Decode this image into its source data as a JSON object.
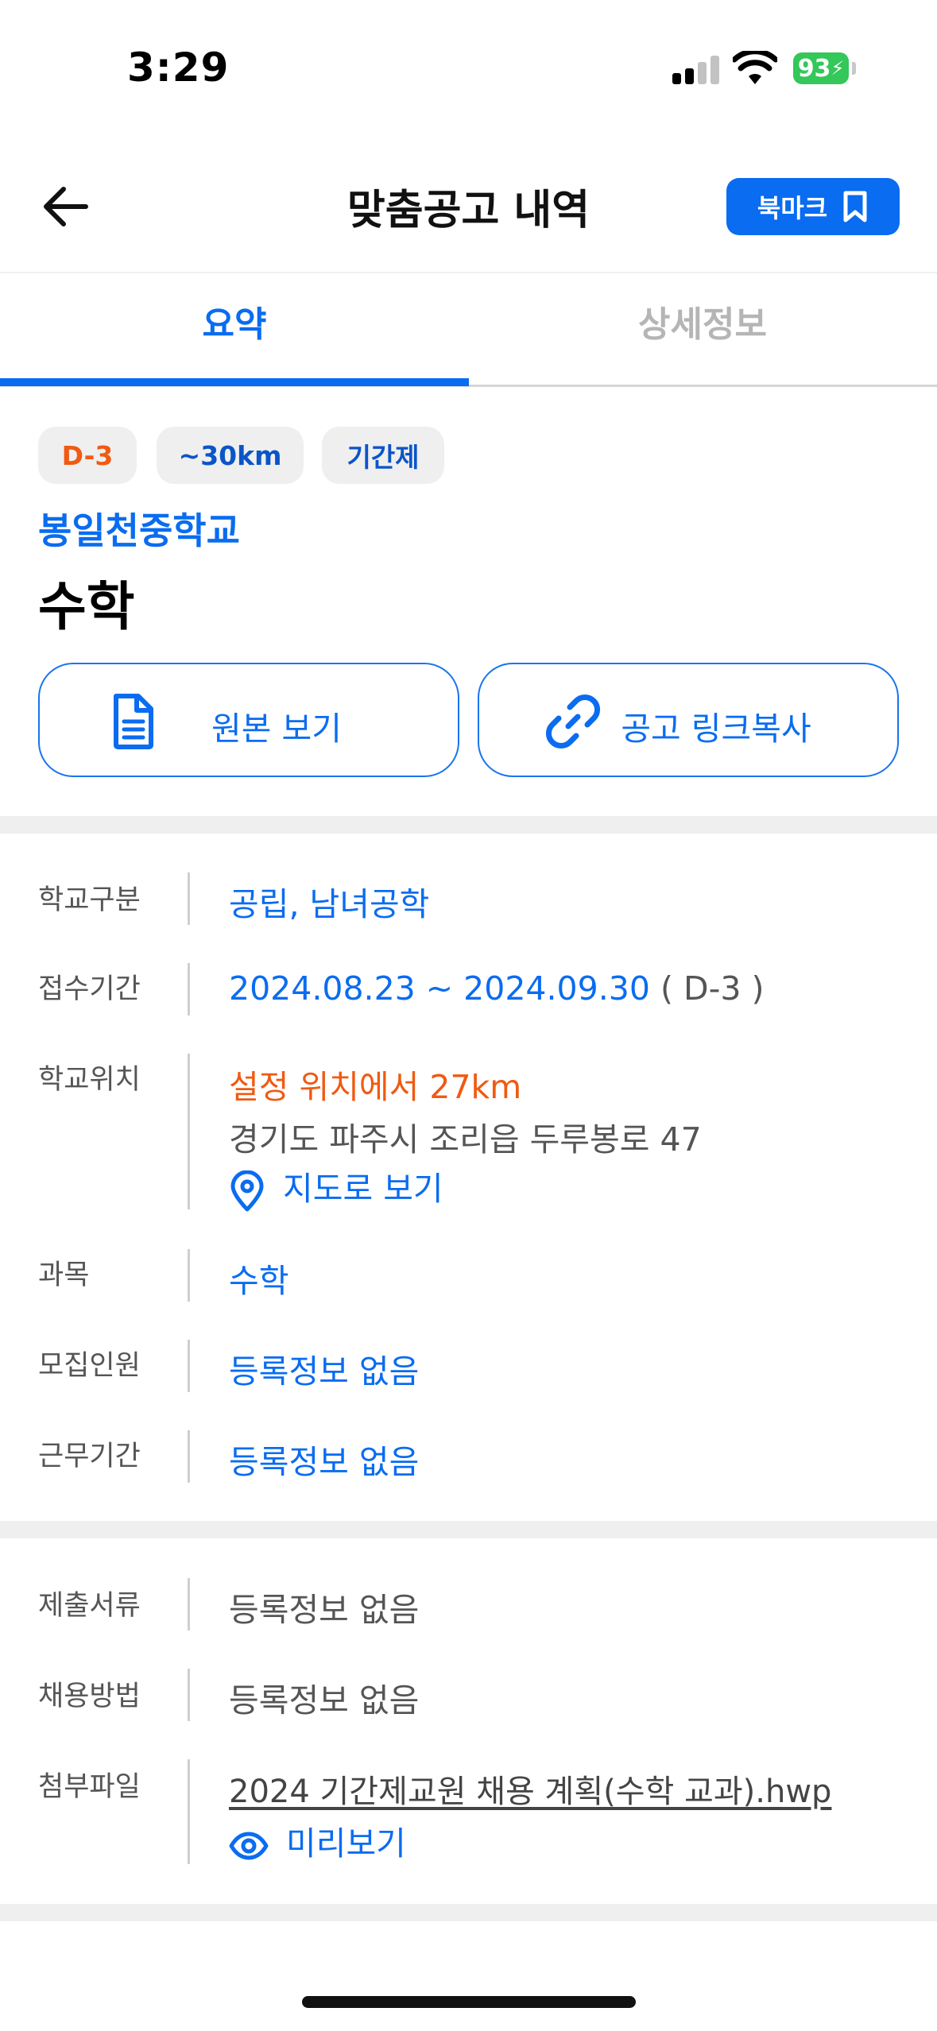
{
  "status_bar": {
    "time": "3:29",
    "battery": "93"
  },
  "header": {
    "title": "맞춤공고 내역",
    "bookmark_label": "북마크"
  },
  "tabs": [
    {
      "label": "요약",
      "active": true
    },
    {
      "label": "상세정보",
      "active": false
    }
  ],
  "summary": {
    "chips": {
      "dday": "D-3",
      "distance": "~30km",
      "type": "기간제"
    },
    "school_name": "봉일천중학교",
    "subject": "수학",
    "view_original_label": "원본 보기",
    "copy_link_label": "공고 링크복사"
  },
  "info": {
    "school_type_label": "학교구분",
    "school_type_value": "공립, 남녀공학",
    "period_label": "접수기간",
    "period_value": "2024.08.23 ~ 2024.09.30",
    "period_dday": "( D-3 )",
    "location_label": "학교위치",
    "location_distance": "설정 위치에서 27km",
    "location_address": "경기도 파주시 조리읍 두루봉로 47",
    "map_link": "지도로 보기",
    "subject_label": "과목",
    "subject_value": "수학",
    "recruit_label": "모집인원",
    "recruit_value": "등록정보 없음",
    "work_period_label": "근무기간",
    "work_period_value": "등록정보 없음"
  },
  "docs": {
    "submit_label": "제출서류",
    "submit_value": "등록정보 없음",
    "method_label": "채용방법",
    "method_value": "등록정보 없음",
    "attachment_label": "첨부파일",
    "attachment_file": "2024 기간제교원 채용 계획(수학 교과).hwp",
    "preview_label": "미리보기"
  },
  "colors": {
    "accent": "#0a6cf0",
    "orange": "#f05a12",
    "battery": "#34c759"
  }
}
